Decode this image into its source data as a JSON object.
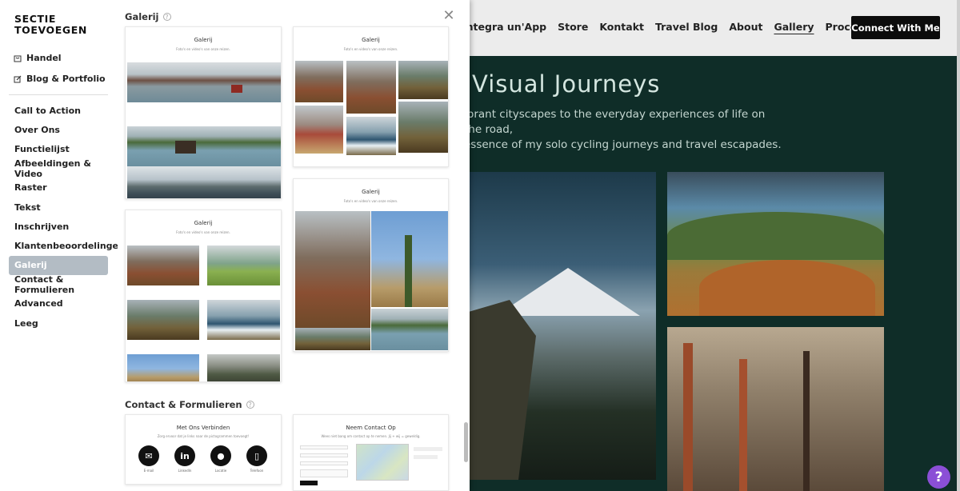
{
  "site": {
    "nav": [
      "Integra un'App",
      "Store",
      "Kontakt",
      "Travel Blog",
      "About",
      "Gallery",
      "Proces"
    ],
    "nav_active": "Gallery",
    "connect_label": "Connect With Me",
    "hero_title": "Visual Journeys",
    "hero_text_1": "ibrant cityscapes to the everyday experiences of life on the road,",
    "hero_text_2": "essence of my solo cycling journeys and travel escapades."
  },
  "help_label": "?",
  "panel": {
    "logo_line1": "SECTIE",
    "logo_line2": "TOEVOEGEN",
    "top_items": [
      {
        "label": "Handel",
        "icon": "shop-icon"
      },
      {
        "label": "Blog & Portfolio",
        "icon": "edit-icon"
      }
    ],
    "items": [
      "Call to Action",
      "Over Ons",
      "Functielijst",
      "Afbeeldingen & Video",
      "Raster",
      "Tekst",
      "Inschrijven",
      "Klantenbeoordelingen",
      "Galerij",
      "Contact & Formulieren",
      "Advanced",
      "Leeg"
    ],
    "active_item": "Galerij"
  },
  "content": {
    "gallery_title": "Galerij",
    "contact_title": "Contact & Formulieren",
    "help_glyph": "?",
    "close_glyph": "✕",
    "card_title": "Galerij",
    "card_sub": "Foto's en video's van onze reizen.",
    "contact_card1_title": "Met Ons Verbinden",
    "contact_card1_sub": "Zorg ervoor dat je links naar de pictogrammen toevoegt!",
    "contact_card2_title": "Neem Contact Op",
    "contact_card2_sub": "Wees niet bang om contact op te nemen. Jij + wij = geweldig.",
    "contact_icons": [
      {
        "glyph": "✉",
        "label": "E-mail"
      },
      {
        "glyph": "in",
        "label": "LinkedIn"
      },
      {
        "glyph": "⬤",
        "label": "Locatie"
      },
      {
        "glyph": "▯",
        "label": "Telefoon"
      }
    ]
  }
}
